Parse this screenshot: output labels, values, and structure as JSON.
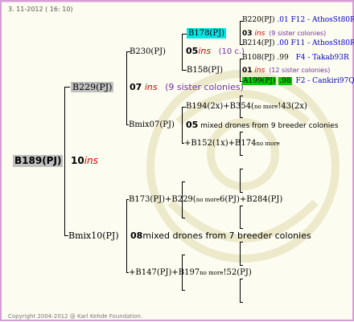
{
  "header": {
    "date": "3. 11-2012 ( 16: 10)"
  },
  "footer": {
    "copyright": "Copyright 2004-2012 @ Karl Kehde Foundation."
  },
  "pedigree": {
    "root": {
      "id": "B189(PJ)"
    },
    "gen1": {
      "num": "10",
      "ins": "ins"
    },
    "sire": {
      "id": "B229(PJ)"
    },
    "sire_gen": {
      "num": "07",
      "ins": "ins",
      "sisters": "(9 sister colonies)"
    },
    "sire_sire": {
      "id": "B230(PJ)"
    },
    "sire_sire_gen": {
      "num": "05",
      "ins": "ins",
      "sisters": "(10 c.)"
    },
    "sss": {
      "id": "B178(PJ)"
    },
    "sss_gen": {
      "num": "03",
      "ins": "ins",
      "sisters": "(9 sister colonies)"
    },
    "ssss_a": {
      "id": "B220(PJ)",
      "tail": ".01 F12 - AthosSt80R"
    },
    "ssss_b": {
      "id": "B214(PJ)",
      "tail": ".00 F11 - AthosSt80R"
    },
    "ssd": {
      "id": "B158(PJ)"
    },
    "ssd_gen": {
      "num": "01",
      "ins": "ins",
      "sisters": "(12 sister colonies)"
    },
    "ssds_a": {
      "id": "B108(PJ)",
      "tail": ".99",
      "tail2": "F4 - Takab93R"
    },
    "ssds_b": {
      "id": "A199(PJ)",
      "tail": ".98",
      "tail2": "F2 - Cankiri97Q"
    },
    "sire_dam": {
      "id": "Bmix07(PJ)"
    },
    "sire_dam_gen": {
      "num": "05",
      "text": "mixed drones from 9 breeder colonies"
    },
    "sdm_a": {
      "id": "B194(2x)+B354(",
      "small": "no more",
      "tail": "!43(2x)"
    },
    "sdm_b": {
      "id": "+B152(1x)+B174",
      "small": "no more"
    },
    "dam": {
      "id": "Bmix10(PJ)"
    },
    "dam_gen": {
      "num": "08",
      "text": "mixed drones from 7 breeder colonies"
    },
    "dm_a": {
      "id": "B173(PJ)+B229(",
      "small": "no more",
      "tail": "6(PJ)+B284(PJ)"
    },
    "dm_b": {
      "id": "+B147(PJ)+B197",
      "small": "no more",
      "tail": "!52(PJ)"
    }
  },
  "colors": {
    "frame": "#d4a0d4",
    "background": "#fdfcf0",
    "ins": "#e00000",
    "tail": "#0000cc",
    "cyan": "#00e5e5",
    "green": "#00cc00",
    "gray": "#c0c0c0"
  }
}
